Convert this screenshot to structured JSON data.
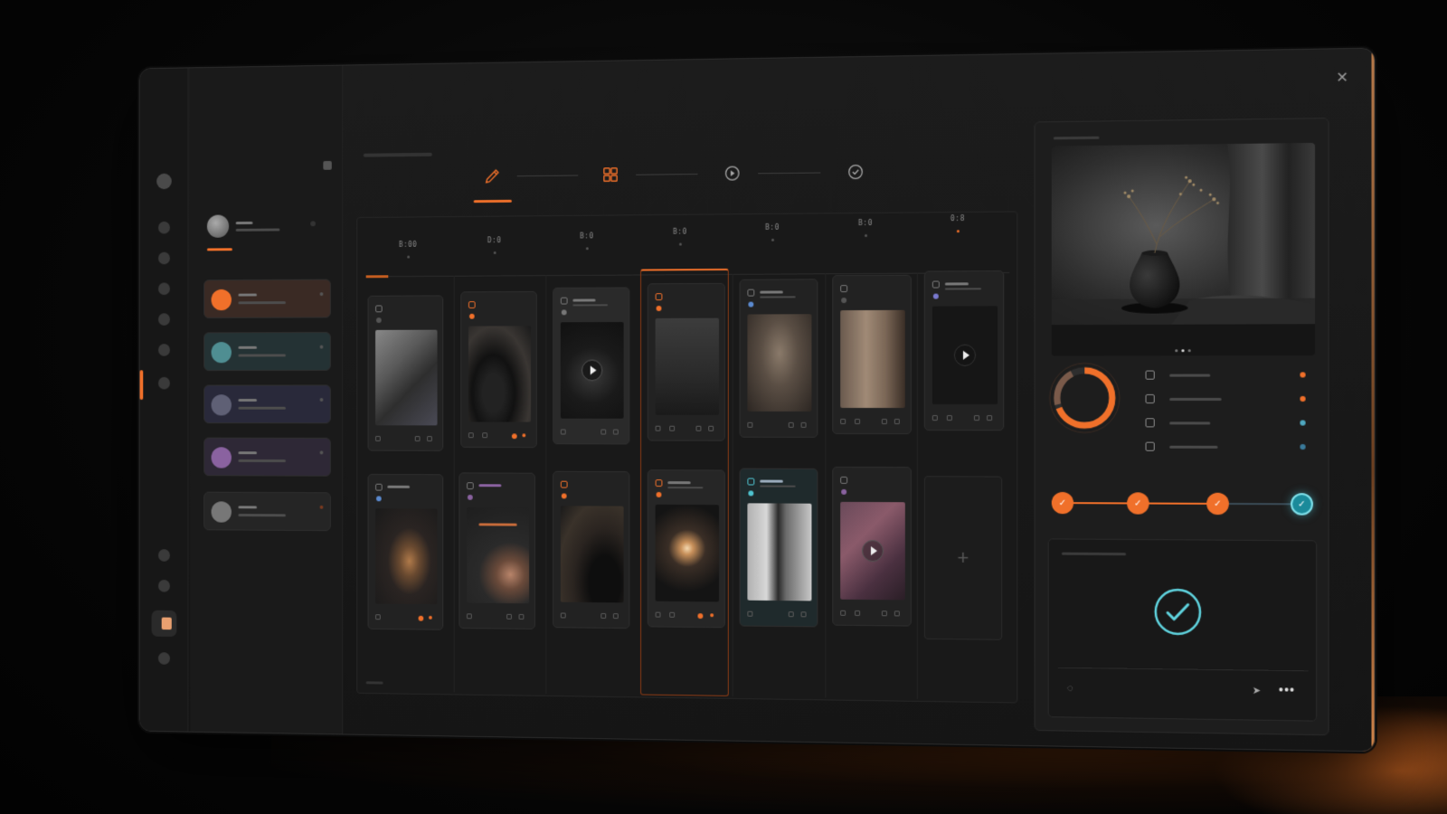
{
  "window": {
    "close_glyph": "✕"
  },
  "rail": {
    "icons": [
      "app-logo-icon",
      "nav-icon-1",
      "nav-icon-2",
      "nav-icon-3",
      "nav-icon-4",
      "nav-icon-5",
      "nav-icon-6",
      "nav-icon-7",
      "nav-icon-8",
      "app-switch-icon",
      "nav-icon-9"
    ]
  },
  "list": {
    "items": [
      {
        "color": "#f0702a"
      },
      {
        "color": "#4f8e92"
      },
      {
        "color": "#5f6075"
      },
      {
        "color": "#8a62a0"
      },
      {
        "color": "#777777"
      }
    ]
  },
  "steps": [
    {
      "icon": "edit-icon",
      "active": true
    },
    {
      "icon": "grid-icon",
      "active": false
    },
    {
      "icon": "play-circle-icon",
      "active": false
    },
    {
      "icon": "check-circle-icon",
      "active": false
    }
  ],
  "board": {
    "columns": [
      {
        "label": "B:00"
      },
      {
        "label": "D:0"
      },
      {
        "label": "B:0"
      },
      {
        "label": "B:0"
      },
      {
        "label": "B:0"
      },
      {
        "label": "B:0"
      },
      {
        "label": "0:8"
      }
    ],
    "add_glyph": "+"
  },
  "status": {
    "progress_steps": 4,
    "completed_steps": 4
  },
  "colors": {
    "accent": "#f0702a",
    "success": "#5fd3de",
    "background": "#151515"
  }
}
